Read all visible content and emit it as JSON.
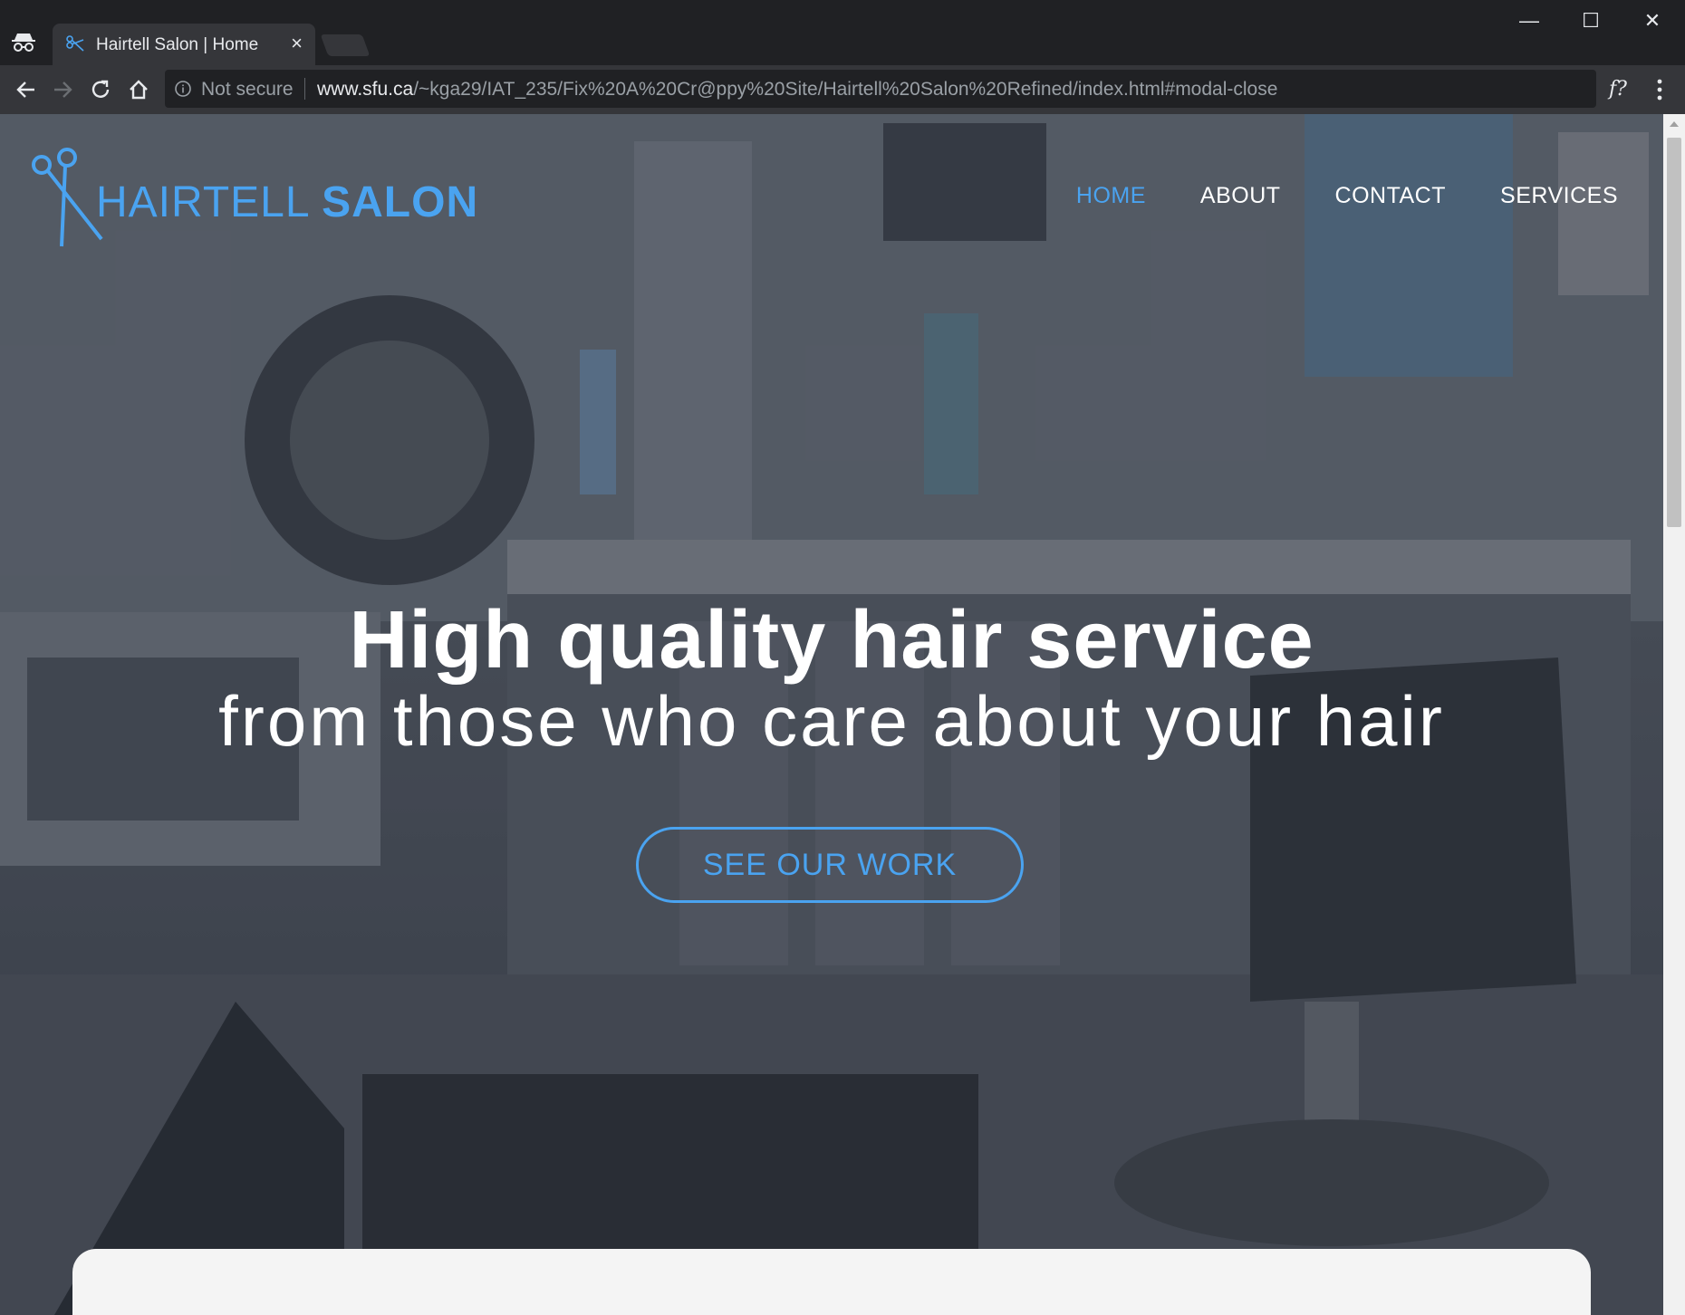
{
  "browser": {
    "tab_title": "Hairtell Salon | Home",
    "tab_close": "×",
    "security_label": "Not secure",
    "url_host": "www.sfu.ca",
    "url_path": "/~kga29/IAT_235/Fix%20A%20Cr@ppy%20Site/Hairtell%20Salon%20Refined/index.html#modal-close",
    "extension_label": "f?",
    "window_controls": {
      "minimize": "—",
      "maximize": "☐",
      "close": "✕"
    }
  },
  "site": {
    "logo": {
      "light": "HAIRTELL",
      "bold": "SALON"
    },
    "nav": [
      {
        "label": "HOME",
        "active": true
      },
      {
        "label": "ABOUT",
        "active": false
      },
      {
        "label": "CONTACT",
        "active": false
      },
      {
        "label": "SERVICES",
        "active": false
      }
    ],
    "hero": {
      "headline": "High quality hair service",
      "subline": "from those who care about your hair",
      "cta_label": "SEE OUR WORK"
    }
  },
  "colors": {
    "accent": "#4aa3f0",
    "chrome_dark": "#202124",
    "chrome_toolbar": "#35363a",
    "card": "#f4f4f4"
  },
  "icons": [
    "incognito-icon",
    "scissors-icon",
    "back-icon",
    "forward-icon",
    "reload-icon",
    "home-icon",
    "info-icon",
    "menu-icon"
  ]
}
